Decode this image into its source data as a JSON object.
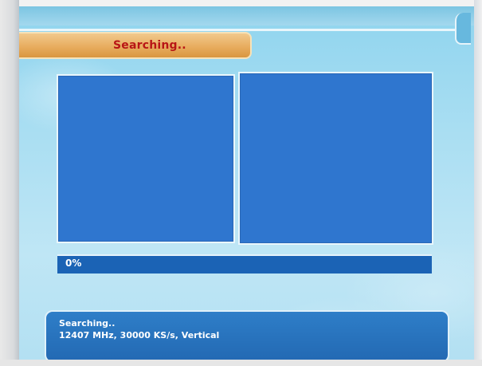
{
  "title": "Searching..",
  "panels": {
    "left": "",
    "right": ""
  },
  "progress": {
    "text": "0%",
    "value": 0
  },
  "status": {
    "line1": "Searching..",
    "line2": "12407 MHz, 30000 KS/s, Vertical"
  },
  "colors": {
    "background_sky": "#a9def2",
    "title_bar": "#e8ad5f",
    "title_text": "#b81616",
    "panel": "#2f76cf",
    "progress_bar": "#1b63b5",
    "status_box": "#2369b3"
  }
}
